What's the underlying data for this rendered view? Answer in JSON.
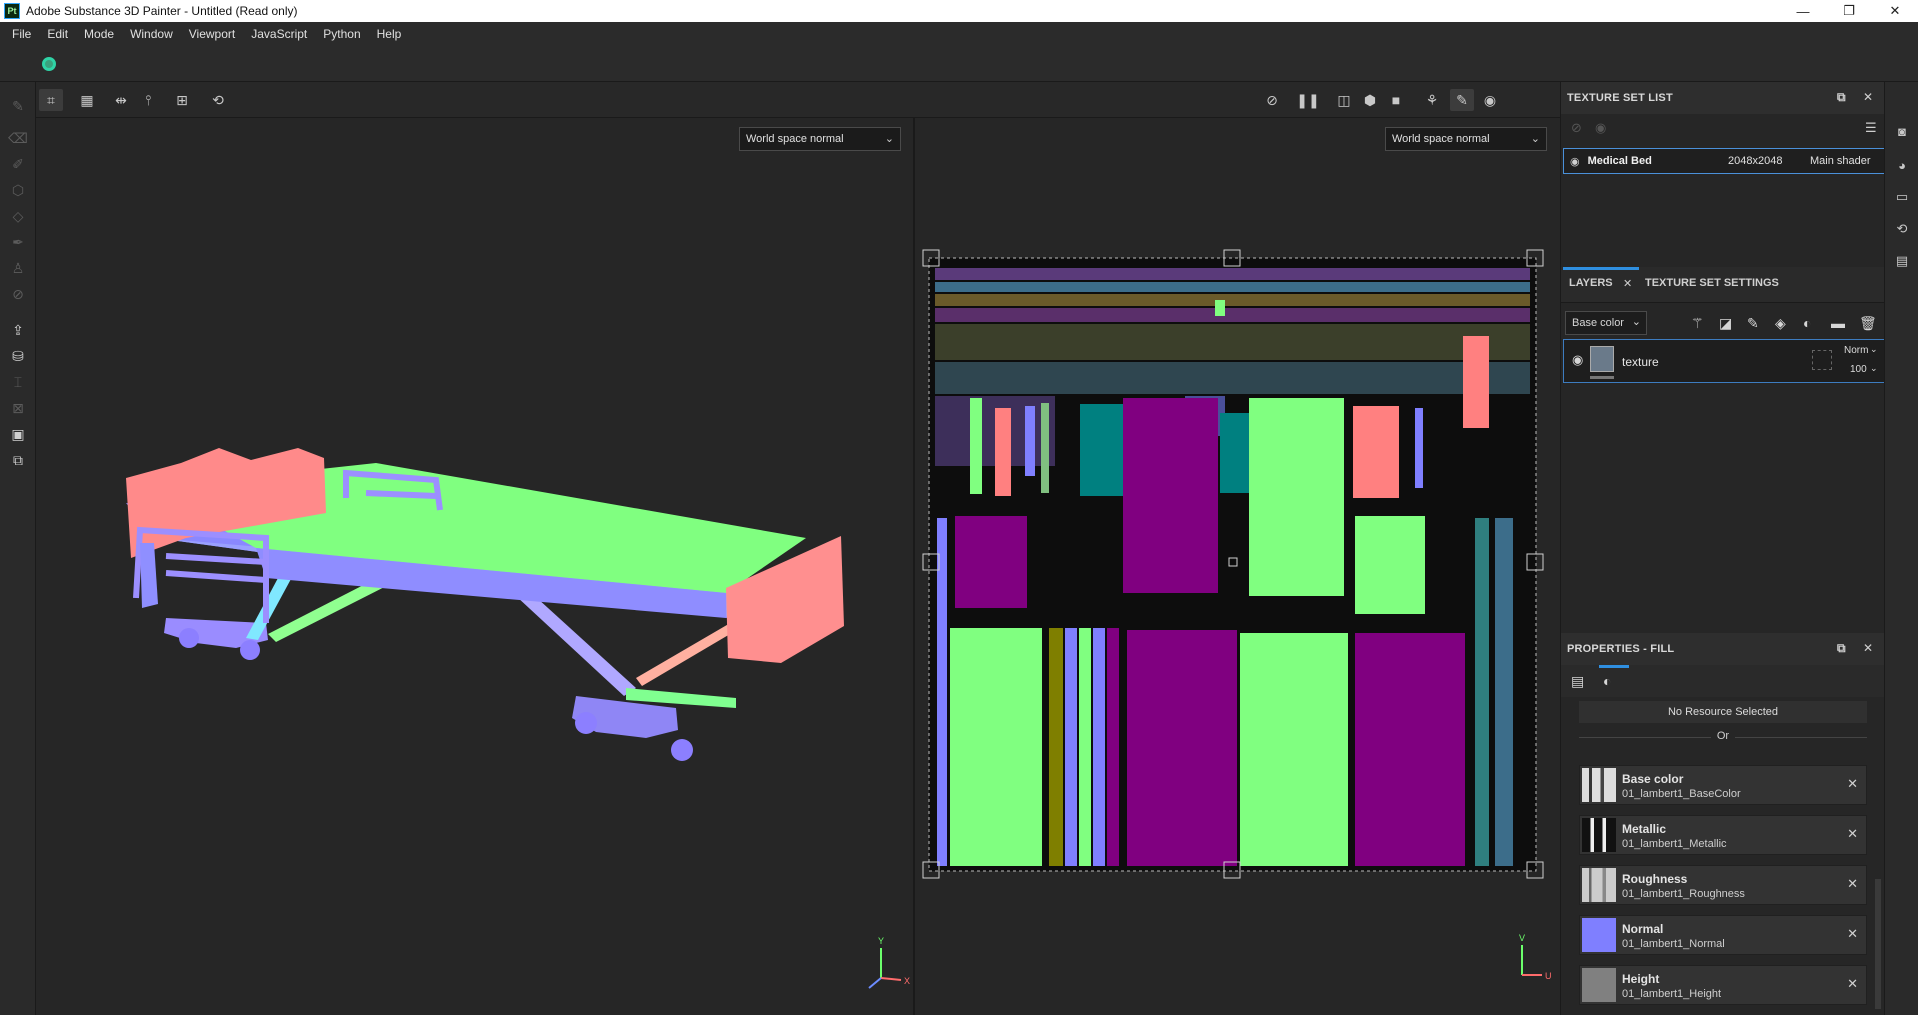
{
  "window": {
    "title": "Adobe Substance 3D Painter - Untitled (Read only)",
    "logo_text": "Pt",
    "minimize": "—",
    "maximize": "❐",
    "close": "✕"
  },
  "menu": [
    "File",
    "Edit",
    "Mode",
    "Window",
    "Viewport",
    "JavaScript",
    "Python",
    "Help"
  ],
  "viewport_3d": {
    "channel": "World space normal"
  },
  "viewport_2d": {
    "channel": "World space normal"
  },
  "texture_set_list": {
    "title": "TEXTURE SET LIST",
    "row": {
      "name": "Medical Bed",
      "resolution": "2048x2048",
      "shader": "Main shader"
    }
  },
  "layers_panel": {
    "tabs": [
      "LAYERS",
      "TEXTURE SET SETTINGS"
    ],
    "channel_dropdown": "Base color",
    "layer": {
      "name": "texture",
      "blend_mode": "Norm",
      "opacity": "100"
    }
  },
  "properties": {
    "title": "PROPERTIES - FILL",
    "no_resource": "No Resource Selected",
    "or_label": "Or",
    "items": [
      {
        "name": "Base color",
        "file": "01_lambert1_BaseColor",
        "thumb_color": "#d9d9d9"
      },
      {
        "name": "Metallic",
        "file": "01_lambert1_Metallic",
        "thumb_color": "#1a1a1a"
      },
      {
        "name": "Roughness",
        "file": "01_lambert1_Roughness",
        "thumb_color": "#cfcfcf"
      },
      {
        "name": "Normal",
        "file": "01_lambert1_Normal",
        "thumb_color": "#8080ff"
      },
      {
        "name": "Height",
        "file": "01_lambert1_Height",
        "thumb_color": "#808080"
      }
    ]
  },
  "axis_gizmo_3d": {
    "y": "Y",
    "x": "X"
  },
  "axis_gizmo_2d": {
    "v": "V",
    "u": "U"
  },
  "colors": {
    "normal_blue": "#7f7fff",
    "normal_green": "#80ff80",
    "normal_pink": "#ff8080",
    "uv_purple": "#800080",
    "uv_teal": "#008080",
    "selection_accent": "#2f8fe0"
  }
}
